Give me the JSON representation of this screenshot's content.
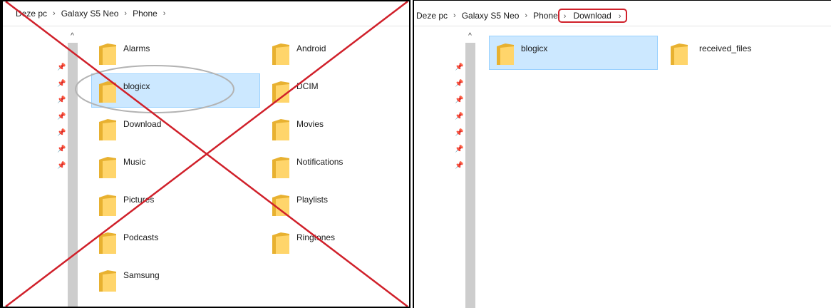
{
  "left_window": {
    "breadcrumb": [
      "Deze pc",
      "Galaxy S5 Neo",
      "Phone"
    ],
    "items": [
      {
        "name": "Alarms",
        "selected": false
      },
      {
        "name": "Android",
        "selected": false
      },
      {
        "name": "blogicx",
        "selected": true
      },
      {
        "name": "DCIM",
        "selected": false
      },
      {
        "name": "Download",
        "selected": false
      },
      {
        "name": "Movies",
        "selected": false
      },
      {
        "name": "Music",
        "selected": false
      },
      {
        "name": "Notifications",
        "selected": false
      },
      {
        "name": "Pictures",
        "selected": false
      },
      {
        "name": "Playlists",
        "selected": false
      },
      {
        "name": "Podcasts",
        "selected": false
      },
      {
        "name": "Ringtones",
        "selected": false
      },
      {
        "name": "Samsung",
        "selected": false
      }
    ],
    "pin_count": 7
  },
  "right_window": {
    "breadcrumb": [
      "Deze pc",
      "Galaxy S5 Neo",
      "Phone",
      "Download"
    ],
    "highlighted_crumb": "Download",
    "items": [
      {
        "name": "blogicx",
        "selected": true
      },
      {
        "name": "received_files",
        "selected": false
      }
    ],
    "pin_count": 7
  },
  "icons": {
    "separator": "›",
    "scroll_up": "^",
    "pin": "📌",
    "folder_icon": "folder-icon",
    "pin_icon": "pin-icon"
  },
  "colors": {
    "selection_bg": "#cce8ff",
    "selection_border": "#99d1ff",
    "folder_back": "#e8b130",
    "folder_front": "#ffd56b",
    "cross_red": "#d0202a",
    "circle_gray": "#b3b3b3",
    "highlight_red": "#d0202a"
  }
}
